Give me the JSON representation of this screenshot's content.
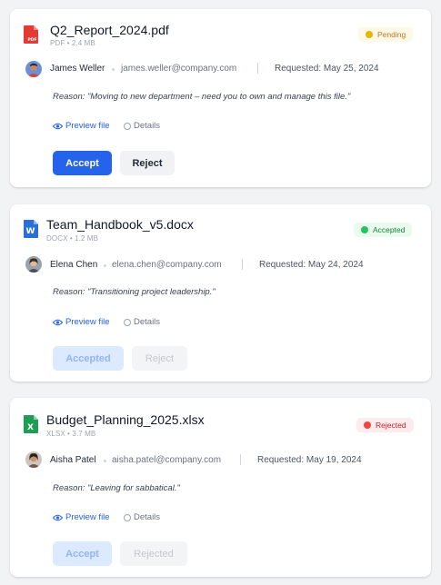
{
  "colors": {
    "primary": "#2563eb",
    "pending": "#eab308",
    "accepted": "#22c55e",
    "rejected": "#ef4444",
    "pdf": "#e53935",
    "docx": "#2b6fd6",
    "xlsx": "#1f9d55"
  },
  "cards": [
    {
      "file_icon": "pdf-file-icon",
      "file_icon_label": "PDF",
      "file_name": "Q2_Report_2024.pdf",
      "file_meta": "PDF • 2.4 MB",
      "status": "Pending",
      "requester_name": "James Weller",
      "requester_email": "james.weller@company.com",
      "requested": "Requested: May 25, 2024",
      "reason": "Reason: \"Moving to new department – need you to own and manage this file.\"",
      "preview_label": "Preview file",
      "details_label": "Details",
      "accept_label": "Accept",
      "reject_label": "Reject"
    },
    {
      "file_icon": "docx-file-icon",
      "file_icon_label": "W",
      "file_name": "Team_Handbook_v5.docx",
      "file_meta": "DOCX • 1.2 MB",
      "status": "Accepted",
      "requester_name": "Elena Chen",
      "requester_email": "elena.chen@company.com",
      "requested": "Requested: May 24, 2024",
      "reason": "Reason: \"Transitioning project leadership.\"",
      "preview_label": "Preview file",
      "details_label": "Details",
      "accept_label": "Accepted",
      "reject_label": "Reject"
    },
    {
      "file_icon": "xlsx-file-icon",
      "file_icon_label": "X",
      "file_name": "Budget_Planning_2025.xlsx",
      "file_meta": "XLSX • 3.7 MB",
      "status": "Rejected",
      "requester_name": "Aisha Patel",
      "requester_email": "aisha.patel@company.com",
      "requested": "Requested: May 19, 2024",
      "reason": "Reason: \"Leaving for sabbatical.\"",
      "preview_label": "Preview file",
      "details_label": "Details",
      "accept_label": "Accept",
      "reject_label": "Rejected"
    }
  ]
}
